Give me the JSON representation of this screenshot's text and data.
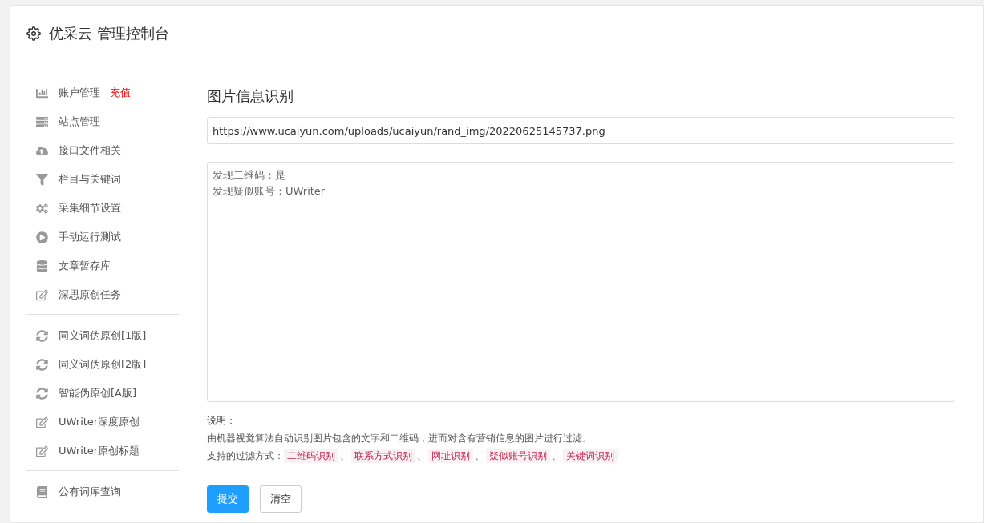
{
  "header": {
    "title": "优采云 管理控制台"
  },
  "sidebar": {
    "groups": [
      {
        "items": [
          {
            "label": "账户管理",
            "badge": "充值"
          },
          {
            "label": "站点管理"
          },
          {
            "label": "接口文件相关"
          },
          {
            "label": "栏目与关键词"
          },
          {
            "label": "采集细节设置"
          },
          {
            "label": "手动运行测试"
          },
          {
            "label": "文章暂存库"
          },
          {
            "label": "深思原创任务"
          }
        ]
      },
      {
        "items": [
          {
            "label": "同义词伪原创[1版]"
          },
          {
            "label": "同义词伪原创[2版]"
          },
          {
            "label": "智能伪原创[A版]"
          },
          {
            "label": "UWriter深度原创"
          },
          {
            "label": "UWriter原创标题"
          }
        ]
      },
      {
        "items": [
          {
            "label": "公有词库查询"
          }
        ]
      }
    ]
  },
  "main": {
    "title": "图片信息识别",
    "url_field": {
      "value": "https://www.ucaiyun.com/uploads/ucaiyun/rand_img/20220625145737.png"
    },
    "result_box": {
      "lines": [
        "发现二维码：是",
        "发现疑似账号：UWriter"
      ]
    },
    "notes": {
      "heading": "说明：",
      "description": "由机器视觉算法自动识别图片包含的文字和二维码，进而对含有营销信息的图片进行过滤。",
      "filters_label": "支持的过滤方式：",
      "separator": "、",
      "filters": [
        "二维码识别",
        "联系方式识别",
        "网址识别",
        "疑似账号识别",
        "关键词识别"
      ]
    },
    "buttons": [
      {
        "label": "提交",
        "kind": "primary"
      },
      {
        "label": "清空",
        "kind": "default"
      }
    ]
  }
}
